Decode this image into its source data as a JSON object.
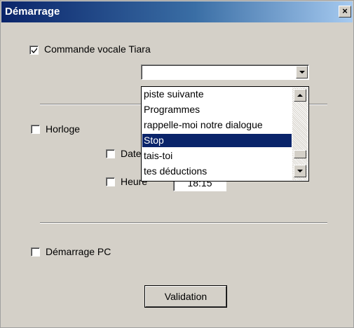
{
  "window": {
    "title": "Démarrage",
    "close_label": "×"
  },
  "voice_command": {
    "label": "Commande vocale Tiara",
    "checked": true,
    "combo_value": "",
    "options": [
      "piste suivante",
      "Programmes",
      "rappelle-moi notre dialogue",
      "Stop",
      "tais-toi",
      "tes déductions"
    ],
    "selected_index": 3
  },
  "clock": {
    "label": "Horloge",
    "checked": false,
    "date_label": "Date",
    "date_checked": false,
    "time_label": "Heure",
    "time_checked": false,
    "time_value": "18:15"
  },
  "pc_startup": {
    "label": "Démarrage PC",
    "checked": false
  },
  "validate_button": {
    "label": "Validation"
  },
  "icons": {
    "check": "check-icon",
    "close": "close-icon",
    "combo_arrow": "chevron-down-icon",
    "scroll_up": "scroll-up-icon",
    "scroll_down": "scroll-down-icon"
  }
}
